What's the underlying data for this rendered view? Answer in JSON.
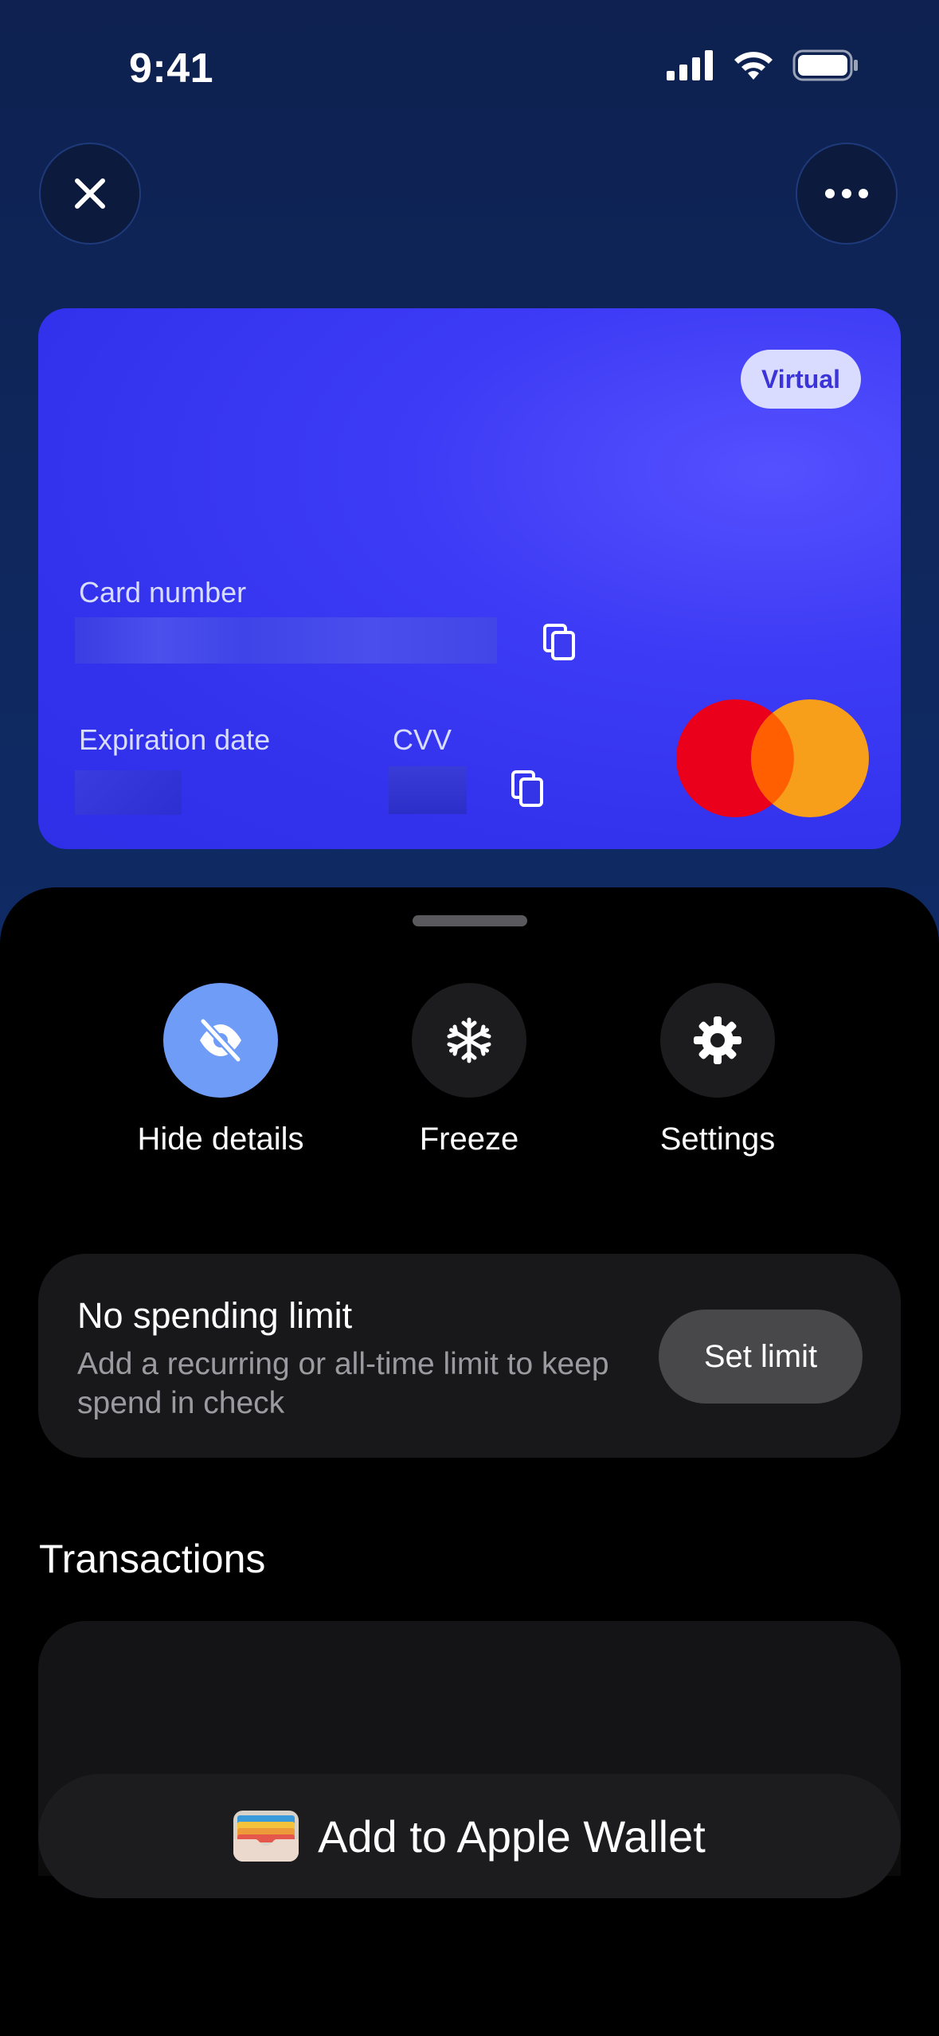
{
  "status_bar": {
    "time": "9:41",
    "icons": [
      "cellular-signal-icon",
      "wifi-icon",
      "battery-icon"
    ]
  },
  "header": {
    "close_icon": "close-icon",
    "more_icon": "more-horizontal-icon"
  },
  "card": {
    "badge": "Virtual",
    "card_number_label": "Card number",
    "expiration_label": "Expiration date",
    "cvv_label": "CVV",
    "network_logo": "mastercard-logo",
    "colors": {
      "card_bg": "#3333ee",
      "badge_bg": "#dadcff",
      "badge_text": "#3b34d8",
      "mc_red": "#eb001b",
      "mc_orange": "#f79e1b"
    }
  },
  "actions": [
    {
      "label": "Hide details",
      "icon": "eye-slash-icon",
      "active": true
    },
    {
      "label": "Freeze",
      "icon": "snowflake-icon",
      "active": false
    },
    {
      "label": "Settings",
      "icon": "gear-icon",
      "active": false
    }
  ],
  "spending_limit": {
    "title": "No spending limit",
    "description": "Add a recurring or all-time limit to keep spend in check",
    "button": "Set limit"
  },
  "transactions": {
    "title": "Transactions"
  },
  "wallet_button": {
    "label": "Add to Apple Wallet",
    "icon": "apple-wallet-icon"
  }
}
